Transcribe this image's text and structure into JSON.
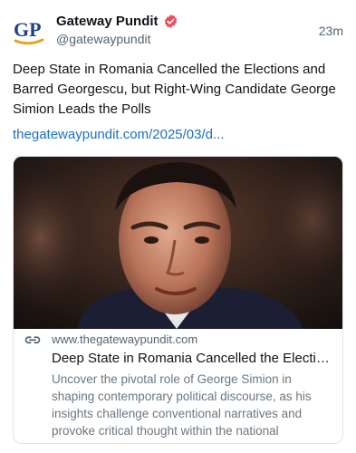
{
  "author": {
    "display_name": "Gateway Pundit",
    "handle": "@gatewaypundit",
    "avatar_text": "GP",
    "verified_icon": "verified-badge-icon",
    "colors": {
      "avatar_blue": "#1f3f8f",
      "avatar_gold": "#e7a324",
      "verified": "#ec4d5b"
    }
  },
  "timestamp": "23m",
  "post": {
    "text": "Deep State in Romania Cancelled the Elections and Barred Georgescu, but Right-Wing Candidate George Simion Leads the Polls",
    "link_text": "thegatewaypundit.com/2025/03/d...",
    "link_color": "#1a6fc7"
  },
  "link_card": {
    "image_alt": "portrait-photo",
    "link_icon": "link-chain-icon",
    "domain": "www.thegatewaypundit.com",
    "title": "Deep State in Romania Cancelled the Elections...",
    "description": "Uncover the pivotal role of George Simion in shaping contemporary political discourse, as his insights challenge conventional narratives and provoke critical thought within the national conversation."
  }
}
